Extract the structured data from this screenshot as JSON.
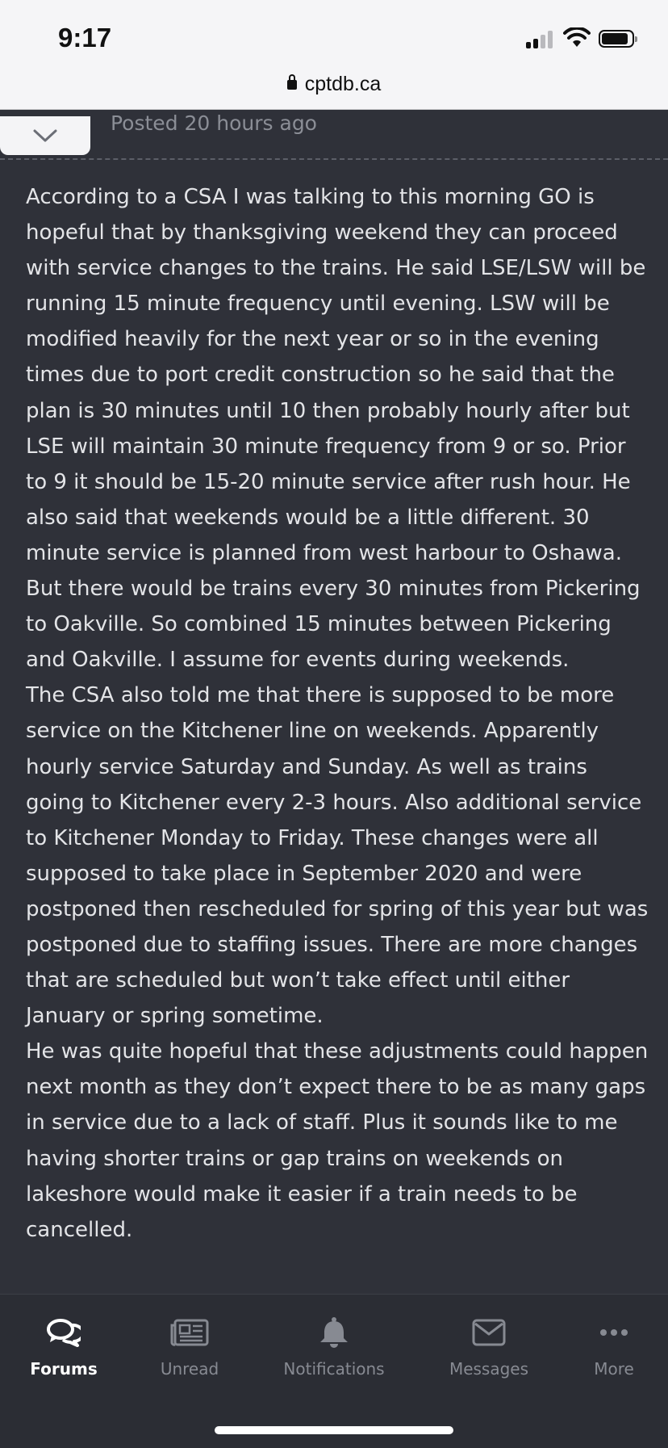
{
  "status_bar": {
    "time": "9:17"
  },
  "browser": {
    "url": "cptdb.ca"
  },
  "post": {
    "posted": "Posted 20 hours ago",
    "paragraphs": [
      "According to a CSA I was talking to this morning GO is hopeful that by thanksgiving weekend they can proceed with service changes to the trains. He said LSE/LSW will be running 15 minute frequency until evening. LSW will be modified heavily for the next year or so in the evening times due to port credit construction so he said that the plan is 30 minutes until 10 then probably hourly after but LSE will maintain 30 minute frequency from 9 or so. Prior to 9 it should be 15-20 minute service after rush hour. He also said that weekends would be a little different. 30 minute service is planned from west harbour to Oshawa. But there would be trains every 30 minutes from Pickering to Oakville. So combined 15 minutes between Pickering and Oakville. I assume for events during weekends.",
      "The CSA also told me that there is supposed to be more service on the Kitchener line on weekends. Apparently hourly service Saturday and Sunday. As well as trains going to Kitchener every 2-3 hours. Also additional service to Kitchener Monday to Friday. These changes were all supposed to take place in September 2020 and were postponed then rescheduled for spring of this year but was postponed due to staffing issues. There are more changes that are scheduled but won’t take effect until either January or spring sometime.",
      "He was quite hopeful that these adjustments could happen next month as they don’t expect there to be as many gaps in service due to a lack of staff. Plus it sounds like to me having shorter trains or gap trains on weekends on lakeshore would make it easier if a train needs to be cancelled."
    ]
  },
  "nav": {
    "items": [
      {
        "label": "Forums",
        "icon": "forums-icon",
        "active": true
      },
      {
        "label": "Unread",
        "icon": "newspaper-icon",
        "active": false
      },
      {
        "label": "Notifications",
        "icon": "bell-icon",
        "active": false
      },
      {
        "label": "Messages",
        "icon": "envelope-icon",
        "active": false
      },
      {
        "label": "More",
        "icon": "more-dots-icon",
        "active": false
      }
    ]
  },
  "colors": {
    "background": "#2f3139",
    "text": "#e3e4e7",
    "nav_inactive": "#878a92",
    "nav_active": "#ffffff"
  }
}
